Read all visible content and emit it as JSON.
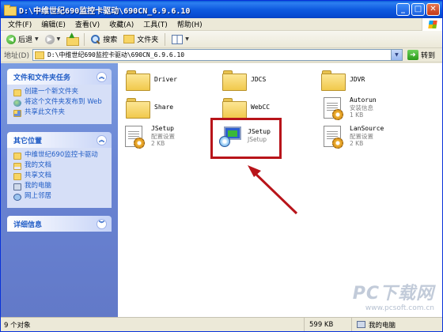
{
  "window": {
    "title": "D:\\中维世纪690监控卡驱动\\690CN_6.9.6.10",
    "buttons": {
      "minimize": "_",
      "maximize": "□",
      "close": "✕"
    }
  },
  "menu": [
    "文件(F)",
    "编辑(E)",
    "查看(V)",
    "收藏(A)",
    "工具(T)",
    "帮助(H)"
  ],
  "toolbar": {
    "back": "后退",
    "search": "搜索",
    "folders": "文件夹"
  },
  "address": {
    "label": "地址(D)",
    "value": "D:\\中维世纪690监控卡驱动\\690CN_6.9.6.10",
    "go": "转到"
  },
  "left_pane": {
    "file_tasks": {
      "title": "文件和文件夹任务",
      "items": [
        "创建一个新文件夹",
        "将这个文件夹发布到 Web",
        "共享此文件夹"
      ]
    },
    "other_places": {
      "title": "其它位置",
      "items": [
        "中维世纪690监控卡驱动",
        "我的文档",
        "共享文档",
        "我的电脑",
        "网上邻居"
      ]
    },
    "details": {
      "title": "详细信息"
    }
  },
  "files": [
    {
      "name": "Driver",
      "type": "folder"
    },
    {
      "name": "JDCS",
      "type": "folder"
    },
    {
      "name": "JDVR",
      "type": "folder"
    },
    {
      "name": "Share",
      "type": "folder"
    },
    {
      "name": "WebCC",
      "type": "folder"
    },
    {
      "name": "Autorun",
      "sub1": "安装信息",
      "sub2": "1 KB",
      "type": "config"
    },
    {
      "name": "JSetup",
      "sub1": "配置设置",
      "sub2": "2 KB",
      "type": "config"
    },
    {
      "name": "JSetup",
      "sub1": "JSetup",
      "type": "exe"
    },
    {
      "name": "LanSource",
      "sub1": "配置设置",
      "sub2": "2 KB",
      "type": "config"
    }
  ],
  "watermark": {
    "big": "PC下载网",
    "small": "www.pcsoft.com.cn"
  },
  "status": {
    "objects": "9 个对象",
    "size": "599 KB",
    "location": "我的电脑"
  },
  "colors": {
    "highlight": "#b8141a",
    "xp_blue": "#0a5bd8",
    "task_pane": "#6a85d4"
  }
}
